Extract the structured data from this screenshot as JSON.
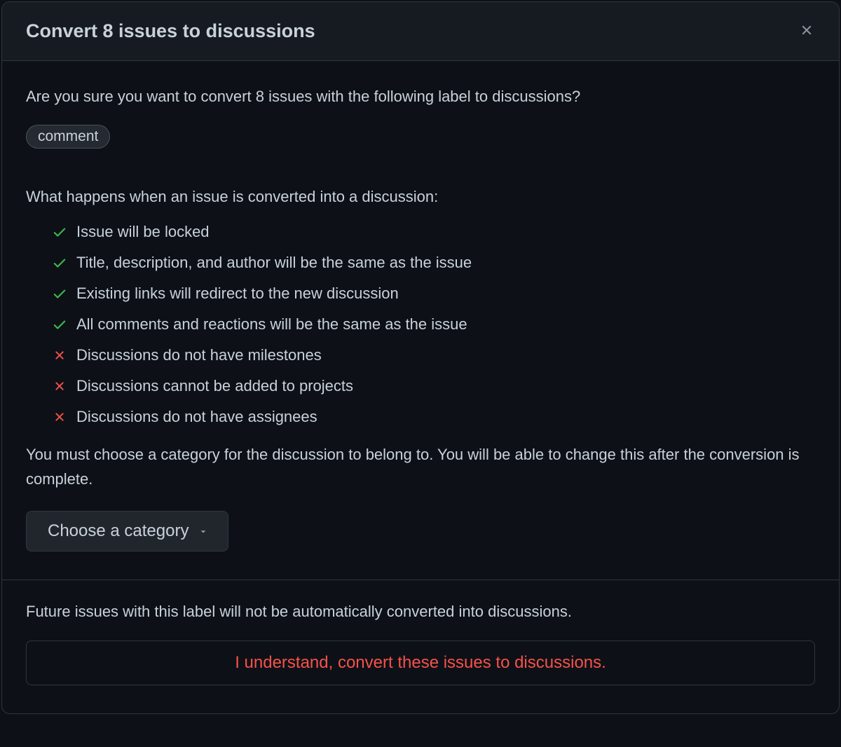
{
  "dialog": {
    "title": "Convert 8 issues to discussions",
    "confirm_text": "Are you sure you want to convert 8 issues with the following label to discussions?",
    "label_name": "comment",
    "effects_heading": "What happens when an issue is converted into a discussion:",
    "effects": [
      {
        "type": "check",
        "text": "Issue will be locked"
      },
      {
        "type": "check",
        "text": "Title, description, and author will be the same as the issue"
      },
      {
        "type": "check",
        "text": "Existing links will redirect to the new discussion"
      },
      {
        "type": "check",
        "text": "All comments and reactions will be the same as the issue"
      },
      {
        "type": "x",
        "text": "Discussions do not have milestones"
      },
      {
        "type": "x",
        "text": "Discussions cannot be added to projects"
      },
      {
        "type": "x",
        "text": "Discussions do not have assignees"
      }
    ],
    "category_prompt": "You must choose a category for the discussion to belong to. You will be able to change this after the conversion is complete.",
    "category_select_label": "Choose a category",
    "footer_note": "Future issues with this label will not be automatically converted into discussions.",
    "confirm_button": "I understand, convert these issues to discussions."
  }
}
